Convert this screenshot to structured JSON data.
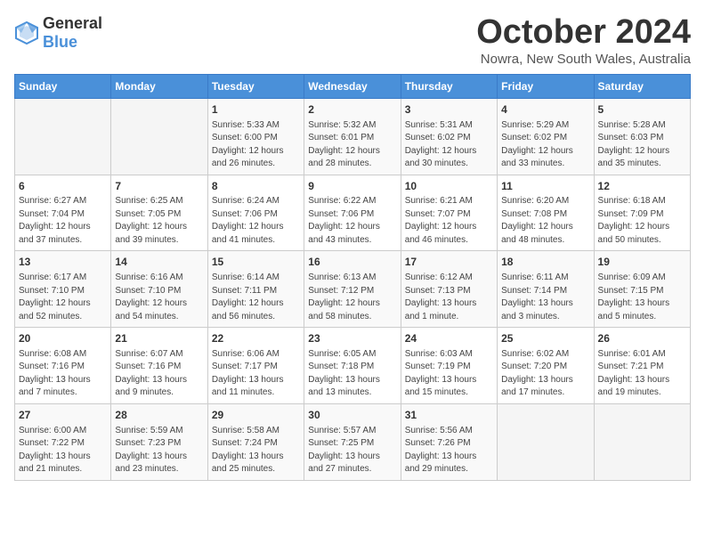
{
  "logo": {
    "text_general": "General",
    "text_blue": "Blue",
    "icon_shape": "flag"
  },
  "header": {
    "month": "October 2024",
    "location": "Nowra, New South Wales, Australia"
  },
  "weekdays": [
    "Sunday",
    "Monday",
    "Tuesday",
    "Wednesday",
    "Thursday",
    "Friday",
    "Saturday"
  ],
  "weeks": [
    [
      {
        "day": "",
        "content": ""
      },
      {
        "day": "",
        "content": ""
      },
      {
        "day": "1",
        "content": "Sunrise: 5:33 AM\nSunset: 6:00 PM\nDaylight: 12 hours\nand 26 minutes."
      },
      {
        "day": "2",
        "content": "Sunrise: 5:32 AM\nSunset: 6:01 PM\nDaylight: 12 hours\nand 28 minutes."
      },
      {
        "day": "3",
        "content": "Sunrise: 5:31 AM\nSunset: 6:02 PM\nDaylight: 12 hours\nand 30 minutes."
      },
      {
        "day": "4",
        "content": "Sunrise: 5:29 AM\nSunset: 6:02 PM\nDaylight: 12 hours\nand 33 minutes."
      },
      {
        "day": "5",
        "content": "Sunrise: 5:28 AM\nSunset: 6:03 PM\nDaylight: 12 hours\nand 35 minutes."
      }
    ],
    [
      {
        "day": "6",
        "content": "Sunrise: 6:27 AM\nSunset: 7:04 PM\nDaylight: 12 hours\nand 37 minutes."
      },
      {
        "day": "7",
        "content": "Sunrise: 6:25 AM\nSunset: 7:05 PM\nDaylight: 12 hours\nand 39 minutes."
      },
      {
        "day": "8",
        "content": "Sunrise: 6:24 AM\nSunset: 7:06 PM\nDaylight: 12 hours\nand 41 minutes."
      },
      {
        "day": "9",
        "content": "Sunrise: 6:22 AM\nSunset: 7:06 PM\nDaylight: 12 hours\nand 43 minutes."
      },
      {
        "day": "10",
        "content": "Sunrise: 6:21 AM\nSunset: 7:07 PM\nDaylight: 12 hours\nand 46 minutes."
      },
      {
        "day": "11",
        "content": "Sunrise: 6:20 AM\nSunset: 7:08 PM\nDaylight: 12 hours\nand 48 minutes."
      },
      {
        "day": "12",
        "content": "Sunrise: 6:18 AM\nSunset: 7:09 PM\nDaylight: 12 hours\nand 50 minutes."
      }
    ],
    [
      {
        "day": "13",
        "content": "Sunrise: 6:17 AM\nSunset: 7:10 PM\nDaylight: 12 hours\nand 52 minutes."
      },
      {
        "day": "14",
        "content": "Sunrise: 6:16 AM\nSunset: 7:10 PM\nDaylight: 12 hours\nand 54 minutes."
      },
      {
        "day": "15",
        "content": "Sunrise: 6:14 AM\nSunset: 7:11 PM\nDaylight: 12 hours\nand 56 minutes."
      },
      {
        "day": "16",
        "content": "Sunrise: 6:13 AM\nSunset: 7:12 PM\nDaylight: 12 hours\nand 58 minutes."
      },
      {
        "day": "17",
        "content": "Sunrise: 6:12 AM\nSunset: 7:13 PM\nDaylight: 13 hours\nand 1 minute."
      },
      {
        "day": "18",
        "content": "Sunrise: 6:11 AM\nSunset: 7:14 PM\nDaylight: 13 hours\nand 3 minutes."
      },
      {
        "day": "19",
        "content": "Sunrise: 6:09 AM\nSunset: 7:15 PM\nDaylight: 13 hours\nand 5 minutes."
      }
    ],
    [
      {
        "day": "20",
        "content": "Sunrise: 6:08 AM\nSunset: 7:16 PM\nDaylight: 13 hours\nand 7 minutes."
      },
      {
        "day": "21",
        "content": "Sunrise: 6:07 AM\nSunset: 7:16 PM\nDaylight: 13 hours\nand 9 minutes."
      },
      {
        "day": "22",
        "content": "Sunrise: 6:06 AM\nSunset: 7:17 PM\nDaylight: 13 hours\nand 11 minutes."
      },
      {
        "day": "23",
        "content": "Sunrise: 6:05 AM\nSunset: 7:18 PM\nDaylight: 13 hours\nand 13 minutes."
      },
      {
        "day": "24",
        "content": "Sunrise: 6:03 AM\nSunset: 7:19 PM\nDaylight: 13 hours\nand 15 minutes."
      },
      {
        "day": "25",
        "content": "Sunrise: 6:02 AM\nSunset: 7:20 PM\nDaylight: 13 hours\nand 17 minutes."
      },
      {
        "day": "26",
        "content": "Sunrise: 6:01 AM\nSunset: 7:21 PM\nDaylight: 13 hours\nand 19 minutes."
      }
    ],
    [
      {
        "day": "27",
        "content": "Sunrise: 6:00 AM\nSunset: 7:22 PM\nDaylight: 13 hours\nand 21 minutes."
      },
      {
        "day": "28",
        "content": "Sunrise: 5:59 AM\nSunset: 7:23 PM\nDaylight: 13 hours\nand 23 minutes."
      },
      {
        "day": "29",
        "content": "Sunrise: 5:58 AM\nSunset: 7:24 PM\nDaylight: 13 hours\nand 25 minutes."
      },
      {
        "day": "30",
        "content": "Sunrise: 5:57 AM\nSunset: 7:25 PM\nDaylight: 13 hours\nand 27 minutes."
      },
      {
        "day": "31",
        "content": "Sunrise: 5:56 AM\nSunset: 7:26 PM\nDaylight: 13 hours\nand 29 minutes."
      },
      {
        "day": "",
        "content": ""
      },
      {
        "day": "",
        "content": ""
      }
    ]
  ]
}
